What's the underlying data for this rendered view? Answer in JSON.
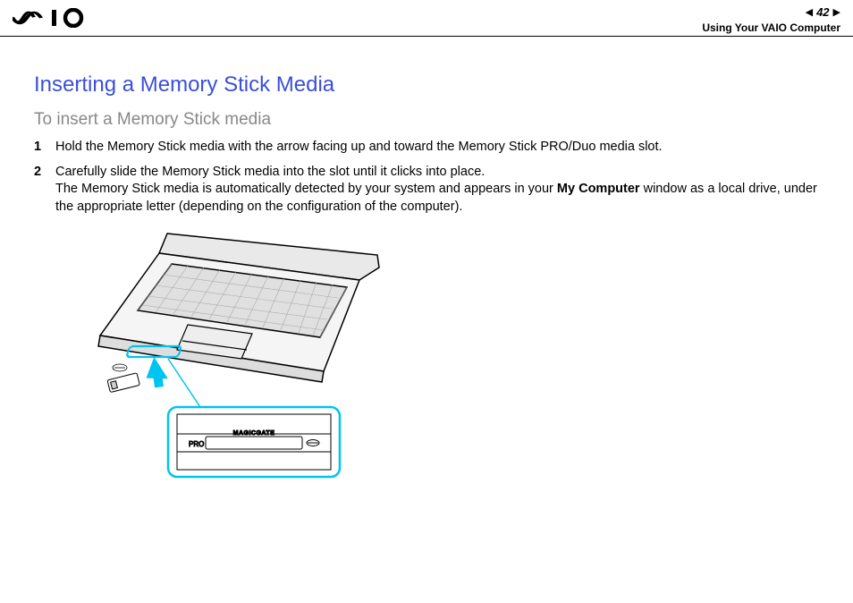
{
  "header": {
    "page_number": "42",
    "section": "Using Your VAIO Computer"
  },
  "content": {
    "heading": "Inserting a Memory Stick Media",
    "subheading": "To insert a Memory Stick media",
    "steps": [
      {
        "num": "1",
        "text": "Hold the Memory Stick media with the arrow facing up and toward the Memory Stick PRO/Duo media slot."
      },
      {
        "num": "2",
        "text_a": "Carefully slide the Memory Stick media into the slot until it clicks into place.",
        "text_b_pre": "The Memory Stick media is automatically detected by your system and appears in your ",
        "text_b_bold": "My Computer",
        "text_b_post": " window as a local drive, under the appropriate letter (depending on the configuration of the computer)."
      }
    ],
    "illustration": {
      "alt": "laptop-memory-stick-diagram",
      "callout_label_pro": "PRO",
      "callout_label_mg": "MAGICGATE"
    }
  }
}
